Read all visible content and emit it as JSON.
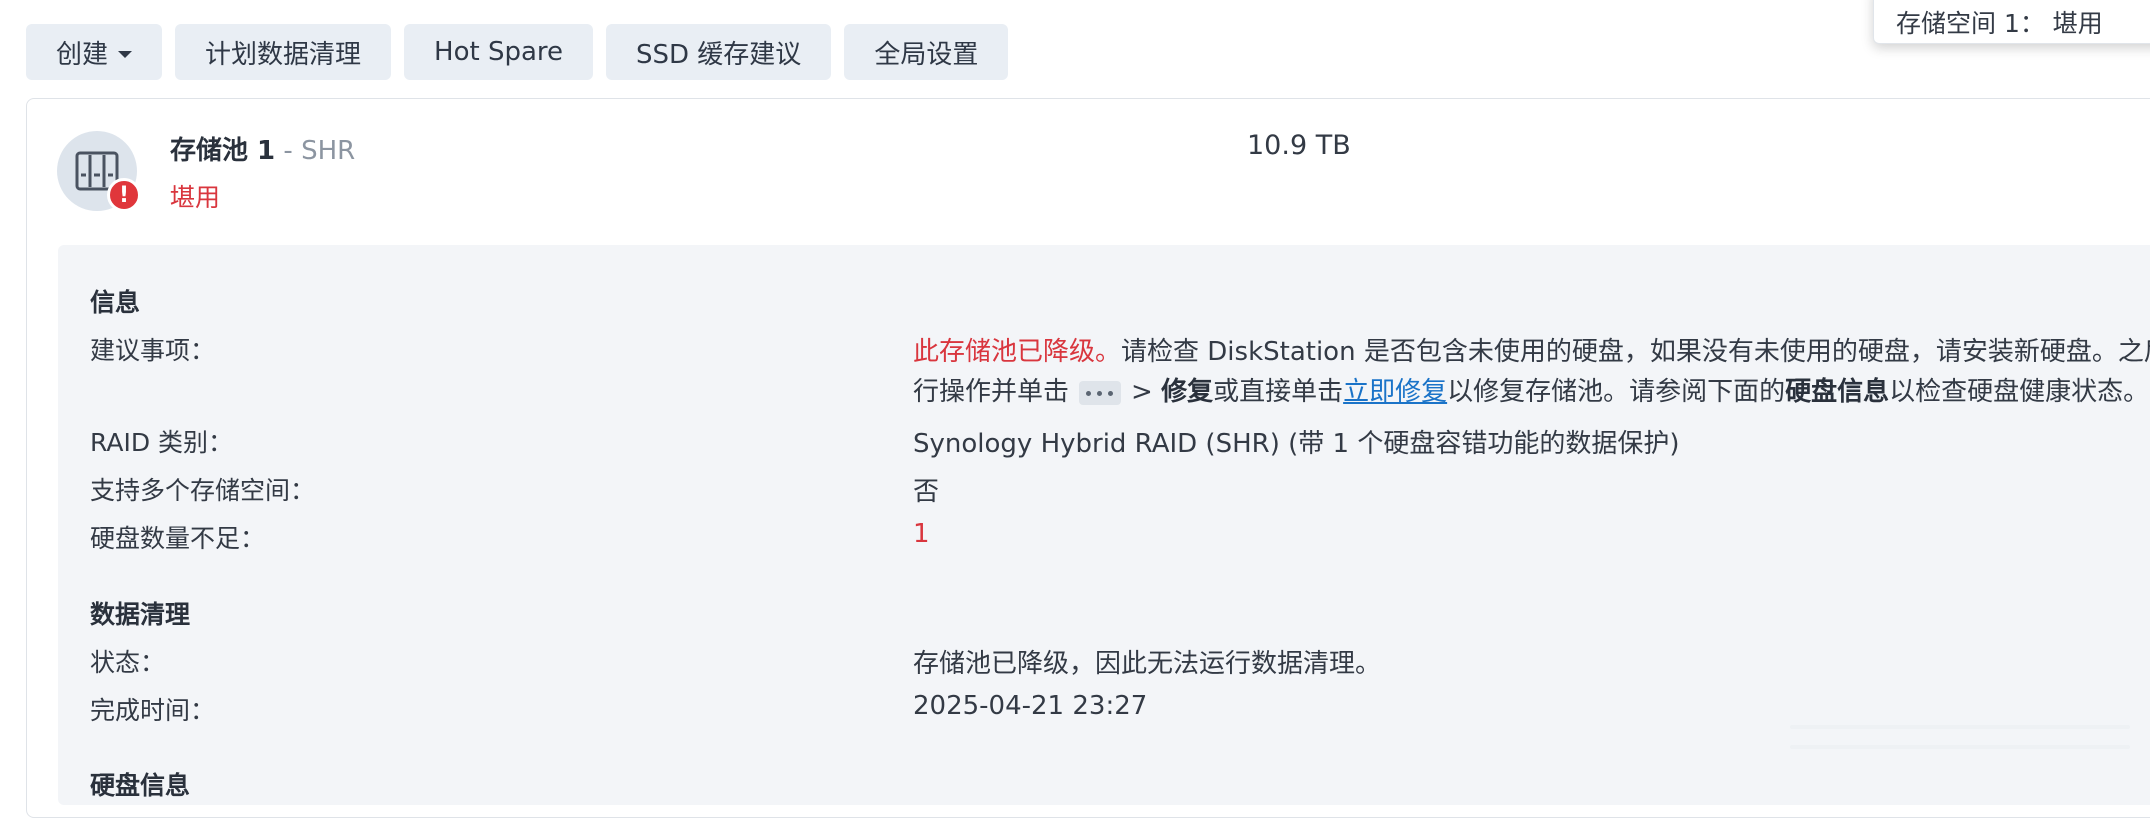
{
  "toolbar": {
    "create_label": "创建",
    "schedule_scrub_label": "计划数据清理",
    "hot_spare_label": "Hot Spare",
    "ssd_cache_label": "SSD 缓存建议",
    "global_settings_label": "全局设置"
  },
  "tooltip": {
    "text": "存储空间 1： 堪用"
  },
  "pool": {
    "name": "存储池 1",
    "separator": " - ",
    "type": "SHR",
    "status": "堪用",
    "size": "10.9 TB",
    "icon": "storage-pool-icon",
    "alert_icon": "exclamation-icon",
    "alert_glyph": "!"
  },
  "info": {
    "heading": "信息",
    "suggestion_label": "建议事项：",
    "suggestion_line1_red": "此存储池已降级。",
    "suggestion_line1_rest": "请检查 DiskStation 是否包含未使用的硬盘，如果没有未使用的硬盘，请安装新硬盘。之后",
    "suggestion_line2_a": "行操作并单击",
    "suggestion_line2_gt": "> ",
    "suggestion_line2_repair": "修复",
    "suggestion_line2_b": "或直接单击",
    "suggestion_line2_link": "立即修复",
    "suggestion_line2_c": "以修复存储池。请参阅下面的",
    "suggestion_line2_disk_info": "硬盘信息",
    "suggestion_line2_d": "以检查硬盘健康状态。",
    "raid_label": "RAID 类别：",
    "raid_value": "Synology Hybrid RAID (SHR) (带 1 个硬盘容错功能的数据保护)",
    "multi_volume_label": "支持多个存储空间：",
    "multi_volume_value": "否",
    "insufficient_disks_label": "硬盘数量不足：",
    "insufficient_disks_value": "1"
  },
  "scrub": {
    "heading": "数据清理",
    "status_label": "状态：",
    "status_value": "存储池已降级，因此无法运行数据清理。",
    "completed_label": "完成时间：",
    "completed_value": "2025-04-21 23:27"
  },
  "disk_info": {
    "heading": "硬盘信息"
  },
  "colors": {
    "error": "#d9363e",
    "link": "#1a73c8",
    "panel_bg": "#f3f5f8",
    "button_bg": "#e9eef4"
  }
}
